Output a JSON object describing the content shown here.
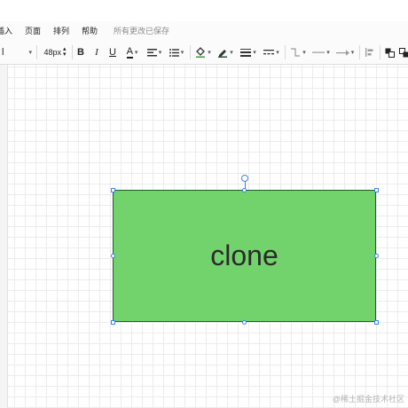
{
  "menu": {
    "items": [
      "插入",
      "页面",
      "排列",
      "帮助"
    ],
    "save_status": "所有更改已保存"
  },
  "toolbar": {
    "font_name_partial": "l",
    "font_size": "48px",
    "bold": "B",
    "italic": "I",
    "underline": "U",
    "font_color": "A"
  },
  "shape": {
    "label": "clone",
    "fill_color": "#72d26c",
    "stroke_color": "#1d5e2b"
  },
  "watermark": "@稀土掘金技术社区",
  "colors": {
    "selection": "#3b82f6",
    "grid": "#ececec"
  }
}
